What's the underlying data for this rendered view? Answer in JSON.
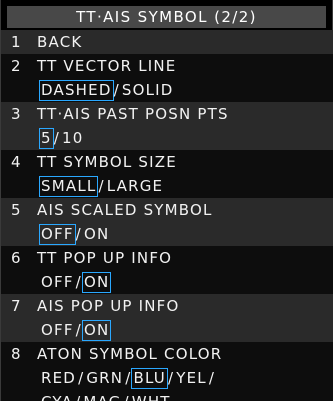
{
  "title": "TT·AIS SYMBOL (2/2)",
  "items": [
    {
      "num": "1",
      "label": "BACK"
    },
    {
      "num": "2",
      "label": "TT VECTOR LINE"
    },
    {
      "num": "3",
      "label": "TT·AIS PAST POSN PTS"
    },
    {
      "num": "4",
      "label": "TT SYMBOL SIZE"
    },
    {
      "num": "5",
      "label": "AIS SCALED SYMBOL"
    },
    {
      "num": "6",
      "label": "TT POP UP INFO"
    },
    {
      "num": "7",
      "label": "AIS POP UP INFO"
    },
    {
      "num": "8",
      "label": "ATON SYMBOL COLOR"
    }
  ],
  "options": {
    "vector_line": [
      "DASHED",
      "SOLID"
    ],
    "past_posn": [
      "5",
      "10"
    ],
    "symbol_size": [
      "SMALL",
      "LARGE"
    ],
    "scaled_symbol": [
      "OFF",
      "ON"
    ],
    "tt_popup": [
      "OFF",
      "ON"
    ],
    "ais_popup": [
      "OFF",
      "ON"
    ],
    "aton_color_line1": [
      "RED",
      "GRN",
      "BLU",
      "YEL"
    ],
    "aton_color_line2": [
      "CYA",
      "MAG",
      "WHT"
    ]
  },
  "separator": "/",
  "selected": {
    "vector_line": "DASHED",
    "past_posn": "5",
    "symbol_size": "SMALL",
    "scaled_symbol": "OFF",
    "tt_popup": "ON",
    "ais_popup": "ON",
    "aton_color": "BLU"
  },
  "colors": {
    "selection_border": "#2aa8ff",
    "row_light": "#2a2a2a",
    "row_dark": "#0d0d0d",
    "title_bar": "#484848",
    "text": "#f2f2f2"
  }
}
